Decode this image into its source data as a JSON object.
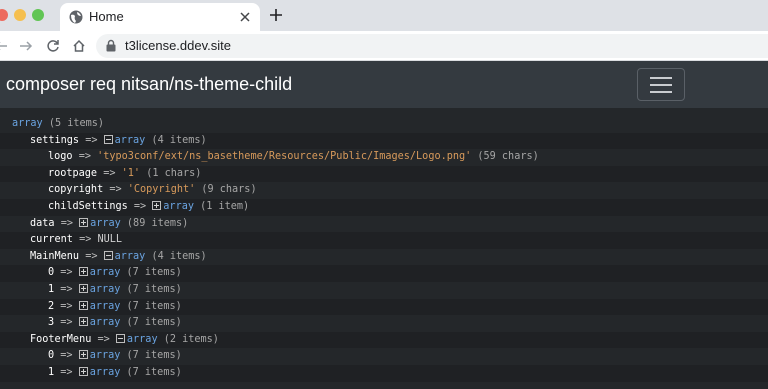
{
  "tab": {
    "title": "Home"
  },
  "address_bar": {
    "url": "t3license.ddev.site"
  },
  "navbar": {
    "brand": "composer req nitsan/ns-theme-child"
  },
  "dump": {
    "root": {
      "label": "array",
      "meta": "(5 items)"
    },
    "settings": {
      "key": "settings",
      "label": "array",
      "meta": "(4 items)"
    },
    "logo": {
      "key": "logo",
      "value": "'typo3conf/ext/ns_basetheme/Resources/Public/Images/Logo.png'",
      "meta": "(59 chars)"
    },
    "rootpage": {
      "key": "rootpage",
      "value": "'1'",
      "meta": "(1 chars)"
    },
    "copyright": {
      "key": "copyright",
      "value": "'Copyright'",
      "meta": "(9 chars)"
    },
    "childSettings": {
      "key": "childSettings",
      "label": "array",
      "meta": "(1 item)"
    },
    "data": {
      "key": "data",
      "label": "array",
      "meta": "(89 items)"
    },
    "current": {
      "key": "current",
      "value": "NULL"
    },
    "MainMenu": {
      "key": "MainMenu",
      "label": "array",
      "meta": "(4 items)"
    },
    "main_items": [
      {
        "key": "0",
        "label": "array",
        "meta": "(7 items)"
      },
      {
        "key": "1",
        "label": "array",
        "meta": "(7 items)"
      },
      {
        "key": "2",
        "label": "array",
        "meta": "(7 items)"
      },
      {
        "key": "3",
        "label": "array",
        "meta": "(7 items)"
      }
    ],
    "FooterMenu": {
      "key": "FooterMenu",
      "label": "array",
      "meta": "(2 items)"
    },
    "footer_items": [
      {
        "key": "0",
        "label": "array",
        "meta": "(7 items)"
      },
      {
        "key": "1",
        "label": "array",
        "meta": "(7 items)"
      }
    ],
    "arrow": "=>"
  }
}
